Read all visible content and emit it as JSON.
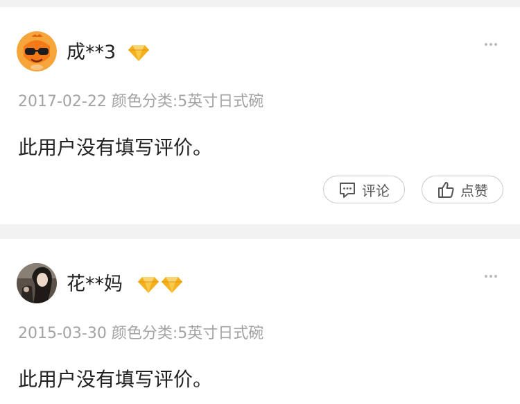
{
  "reviews": [
    {
      "username": "成**3",
      "diamond_count": 1,
      "avatar_icon": "orange-mascot-sunglasses-avatar",
      "meta": "2017-02-22 颜色分类:5英寸日式碗",
      "content": "此用户没有填写评价。",
      "comment_label": "评论",
      "like_label": "点赞"
    },
    {
      "username": "花**妈",
      "diamond_count": 2,
      "avatar_icon": "user-photo-avatar",
      "meta": "2015-03-30 颜色分类:5英寸日式碗",
      "content": "此用户没有填写评价。"
    }
  ],
  "colors": {
    "diamond": "#f5b01e",
    "meta_text": "#a3a3a3",
    "body_text": "#222222",
    "page_bg": "#f2f2f2",
    "card_bg": "#ffffff"
  }
}
